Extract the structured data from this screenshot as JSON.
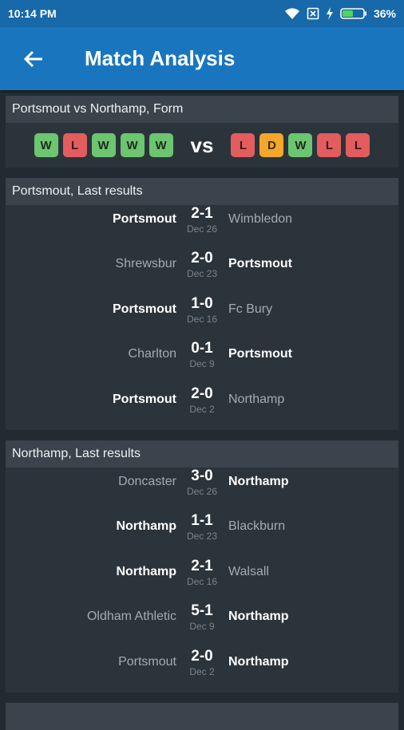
{
  "status_bar": {
    "time": "10:14 PM",
    "battery": "36%"
  },
  "header": {
    "title": "Match Analysis"
  },
  "form": {
    "title": "Portsmout vs Northamp, Form",
    "home": [
      "W",
      "L",
      "W",
      "W",
      "W"
    ],
    "vs": "vs",
    "away": [
      "L",
      "D",
      "W",
      "L",
      "L"
    ]
  },
  "home_results": {
    "title": "Portsmout, Last results",
    "rows": [
      {
        "home": "Portsmout",
        "away": "Wimbledon",
        "score": "2-1",
        "date": "Dec 26",
        "highlight": "home"
      },
      {
        "home": "Shrewsbur",
        "away": "Portsmout",
        "score": "2-0",
        "date": "Dec 23",
        "highlight": "away"
      },
      {
        "home": "Portsmout",
        "away": "Fc Bury",
        "score": "1-0",
        "date": "Dec 16",
        "highlight": "home"
      },
      {
        "home": "Charlton",
        "away": "Portsmout",
        "score": "0-1",
        "date": "Dec 9",
        "highlight": "away"
      },
      {
        "home": "Portsmout",
        "away": "Northamp",
        "score": "2-0",
        "date": "Dec 2",
        "highlight": "home"
      }
    ]
  },
  "away_results": {
    "title": "Northamp, Last results",
    "rows": [
      {
        "home": "Doncaster",
        "away": "Northamp",
        "score": "3-0",
        "date": "Dec 26",
        "highlight": "away"
      },
      {
        "home": "Northamp",
        "away": "Blackburn",
        "score": "1-1",
        "date": "Dec 23",
        "highlight": "home"
      },
      {
        "home": "Northamp",
        "away": "Walsall",
        "score": "2-1",
        "date": "Dec 16",
        "highlight": "home"
      },
      {
        "home": "Oldham Athletic",
        "away": "Northamp",
        "score": "5-1",
        "date": "Dec 9",
        "highlight": "away"
      },
      {
        "home": "Portsmout",
        "away": "Northamp",
        "score": "2-0",
        "date": "Dec 2",
        "highlight": "away"
      }
    ]
  }
}
